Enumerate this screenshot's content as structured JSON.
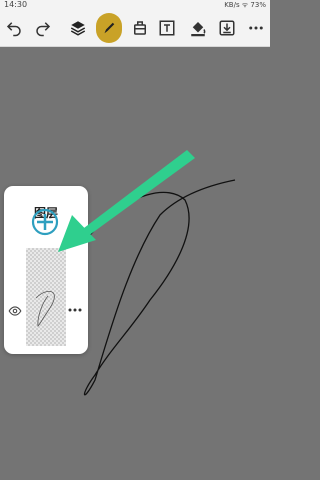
{
  "statusbar": {
    "time": "14:30",
    "indicators": "KB/s  ᯤ  73%"
  },
  "toolbar": {
    "items": [
      {
        "name": "undo-icon"
      },
      {
        "name": "redo-icon"
      },
      {
        "name": "layers-icon"
      },
      {
        "name": "pen-icon",
        "active": true
      },
      {
        "name": "eraser-icon"
      },
      {
        "name": "text-icon"
      },
      {
        "name": "fill-icon"
      },
      {
        "name": "save-icon"
      },
      {
        "name": "more-icon"
      }
    ],
    "active_color": "#c9a227"
  },
  "layers_panel": {
    "title": "图层"
  },
  "colors": {
    "accent_green": "#2fcf8e",
    "add_button": "#2e9fbf"
  }
}
